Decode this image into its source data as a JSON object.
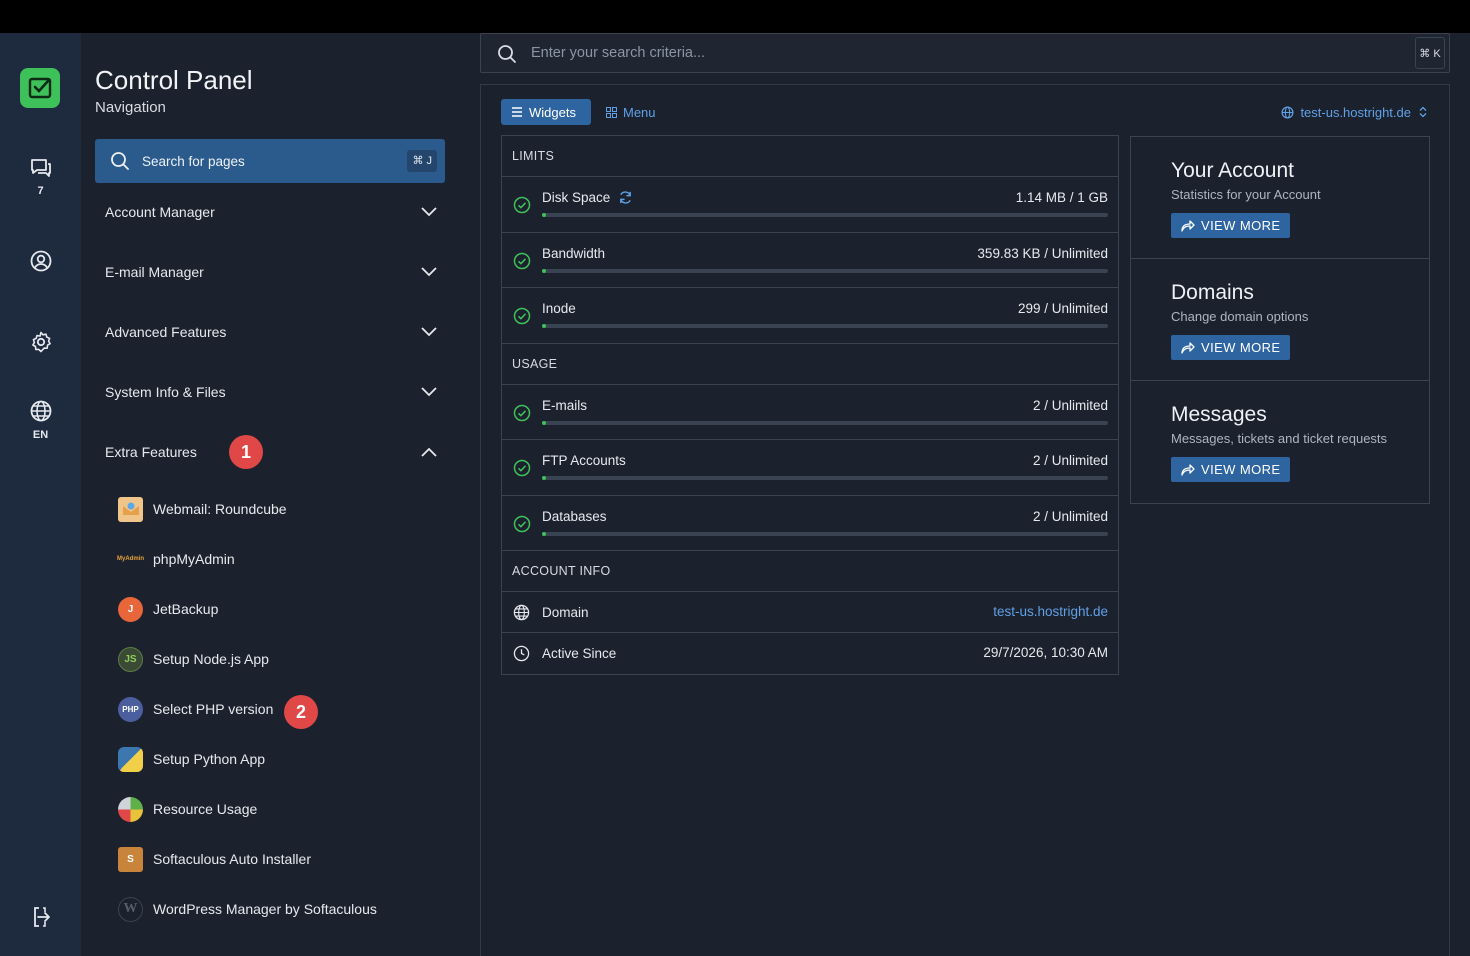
{
  "rail": {
    "messages_count": "7",
    "language": "EN"
  },
  "sidebar": {
    "title": "Control Panel",
    "subtitle": "Navigation",
    "search_label": "Search for pages",
    "search_shortcut": "⌘ J",
    "sections": [
      {
        "label": "Account Manager"
      },
      {
        "label": "E-mail Manager"
      },
      {
        "label": "Advanced Features"
      },
      {
        "label": "System Info & Files"
      },
      {
        "label": "Extra Features",
        "badge": "1",
        "expanded": true
      }
    ],
    "extra_items": [
      {
        "label": "Webmail: Roundcube",
        "icon": "roundcube-icon"
      },
      {
        "label": "phpMyAdmin",
        "icon": "phpmyadmin-icon"
      },
      {
        "label": "JetBackup",
        "icon": "jetbackup-icon"
      },
      {
        "label": "Setup Node.js App",
        "icon": "nodejs-icon"
      },
      {
        "label": "Select PHP version",
        "icon": "php-icon",
        "badge": "2"
      },
      {
        "label": "Setup Python App",
        "icon": "python-icon"
      },
      {
        "label": "Resource Usage",
        "icon": "resource-usage-icon"
      },
      {
        "label": "Softaculous Auto Installer",
        "icon": "softaculous-icon"
      },
      {
        "label": "WordPress Manager by Softaculous",
        "icon": "wordpress-icon"
      }
    ]
  },
  "main": {
    "search_placeholder": "Enter your search criteria...",
    "search_shortcut": "⌘ K",
    "tabs": {
      "widgets": "Widgets",
      "menu": "Menu"
    },
    "domain_selector": "test-us.hostright.de",
    "limits": {
      "header": "LIMITS",
      "rows": [
        {
          "label": "Disk Space",
          "value": "1.14 MB / 1 GB",
          "usage": 0.001
        },
        {
          "label": "Bandwidth",
          "value": "359.83 KB / Unlimited",
          "usage": 0
        },
        {
          "label": "Inode",
          "value": "299 / Unlimited",
          "usage": 0
        }
      ]
    },
    "usage": {
      "header": "USAGE",
      "rows": [
        {
          "label": "E-mails",
          "value": "2 / Unlimited",
          "usage": 0
        },
        {
          "label": "FTP Accounts",
          "value": "2 / Unlimited",
          "usage": 0
        },
        {
          "label": "Databases",
          "value": "2 / Unlimited",
          "usage": 0
        }
      ]
    },
    "account_info": {
      "header": "ACCOUNT INFO",
      "domain_label": "Domain",
      "domain_value": "test-us.hostright.de",
      "active_label": "Active Since",
      "active_value": "29/7/2026, 10:30 AM"
    },
    "cards": [
      {
        "title": "Your Account",
        "desc": "Statistics for your Account",
        "button": "VIEW MORE"
      },
      {
        "title": "Domains",
        "desc": "Change domain options",
        "button": "VIEW MORE"
      },
      {
        "title": "Messages",
        "desc": "Messages, tickets and ticket requests",
        "button": "VIEW MORE"
      }
    ]
  },
  "colors": {
    "accent": "#2e64a0",
    "success": "#3ec15a",
    "badge": "#e04848",
    "link": "#5fa0e6"
  }
}
